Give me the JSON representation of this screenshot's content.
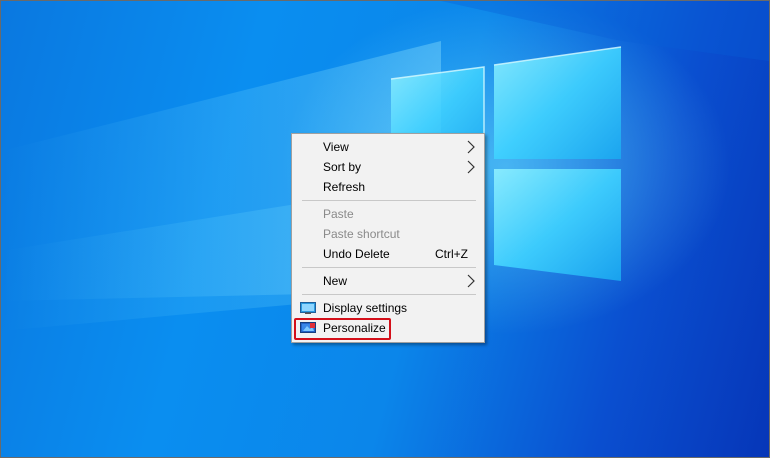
{
  "desktop": {
    "background_colors": [
      "#0a78e0",
      "#0a8ef0",
      "#0636b8"
    ],
    "logo_color": "#3fd2ff"
  },
  "context_menu": {
    "view": {
      "label": "View",
      "submenu_icon": "chevron-right-icon"
    },
    "sort_by": {
      "label": "Sort by",
      "submenu_icon": "chevron-right-icon"
    },
    "refresh": {
      "label": "Refresh"
    },
    "paste": {
      "label": "Paste",
      "disabled": true
    },
    "paste_shortcut": {
      "label": "Paste shortcut",
      "disabled": true
    },
    "undo_delete": {
      "label": "Undo Delete",
      "shortcut": "Ctrl+Z"
    },
    "new": {
      "label": "New",
      "submenu_icon": "chevron-right-icon"
    },
    "display_settings": {
      "label": "Display settings",
      "icon": "display-settings-icon"
    },
    "personalize": {
      "label": "Personalize",
      "icon": "personalize-icon",
      "highlight_color": "#d4101a"
    }
  }
}
